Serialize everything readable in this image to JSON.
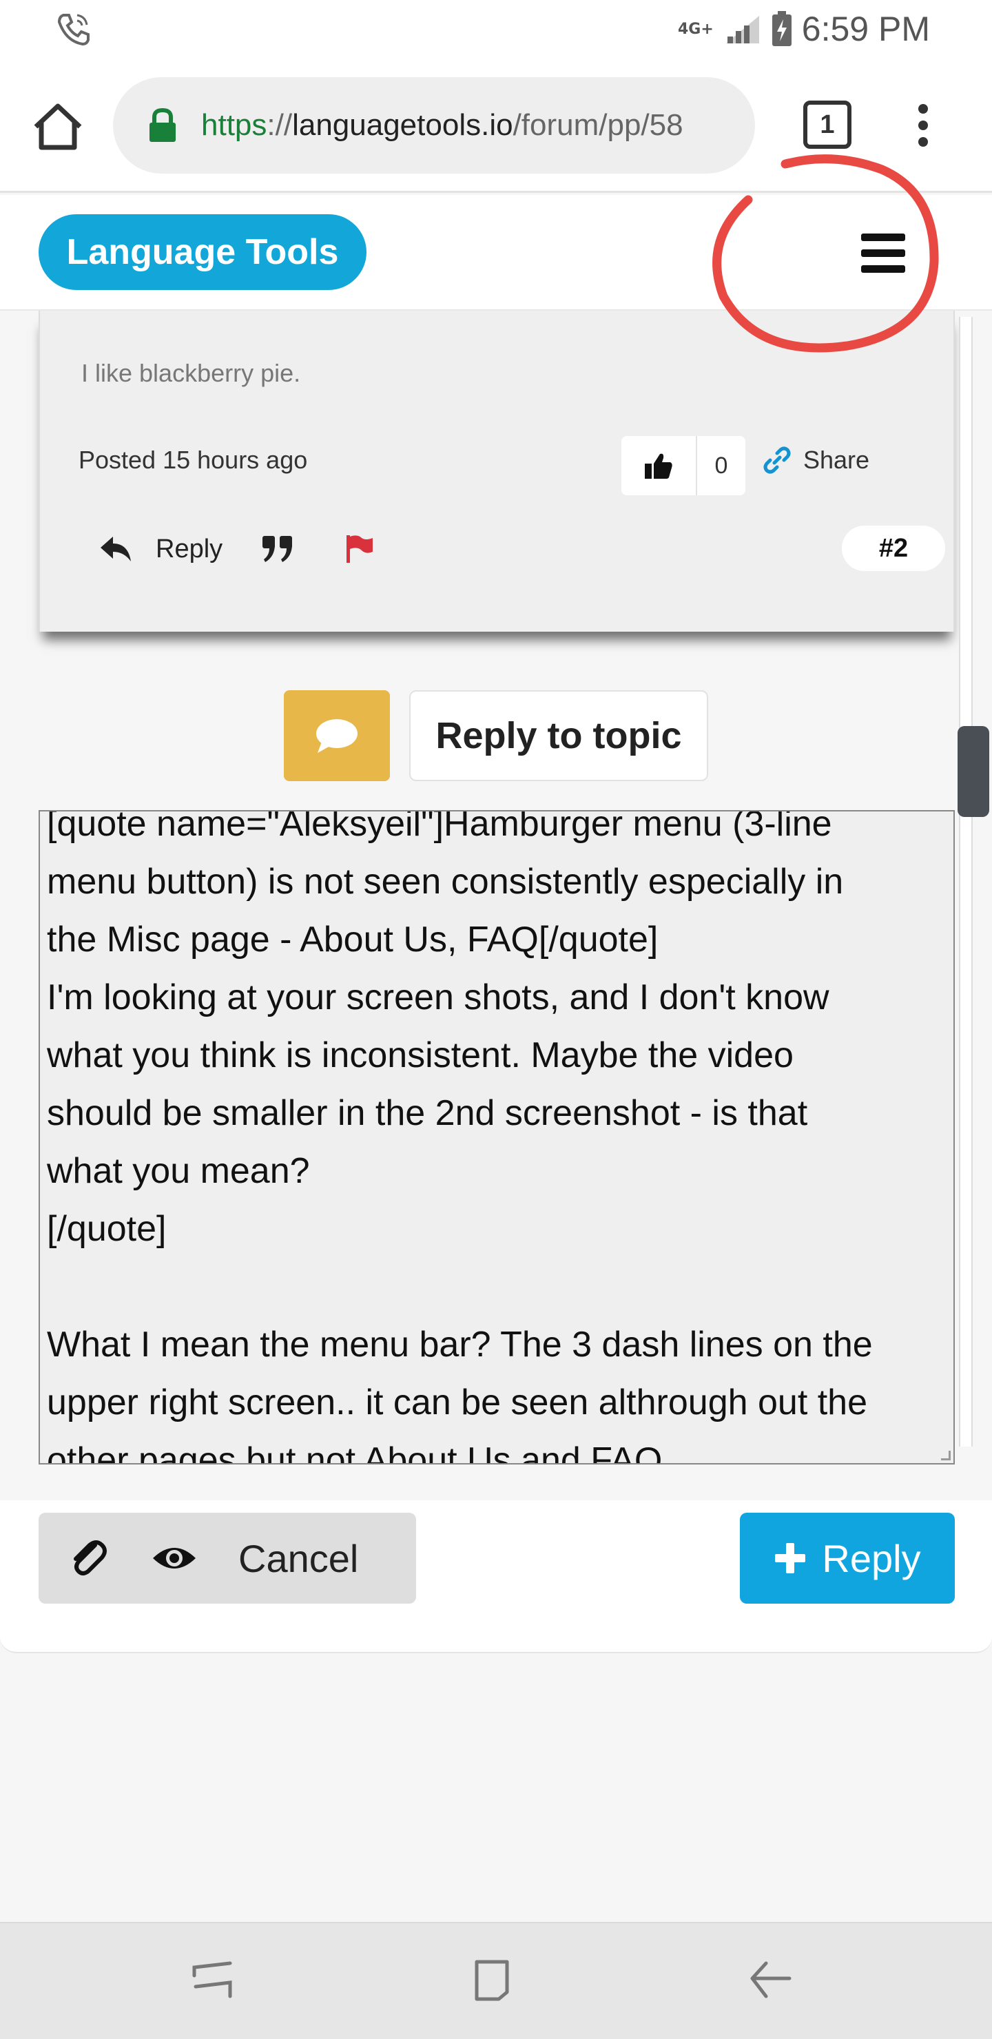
{
  "status_bar": {
    "network": "4G+",
    "time": "6:59 PM",
    "icons": [
      "phone-call-icon",
      "signal-icon",
      "battery-charging-icon"
    ]
  },
  "browser": {
    "url_scheme": "https",
    "url_sep": "://",
    "url_host": "languagetools.io",
    "url_path": "/forum/pp/58",
    "tab_count": "1",
    "icons": [
      "home-icon",
      "lock-icon",
      "tabs-icon",
      "more-vert-icon"
    ]
  },
  "site": {
    "brand": "Language Tools",
    "menu_icon": "hamburger-icon"
  },
  "post": {
    "body": "I like blackberry pie.",
    "posted": "Posted 15 hours ago",
    "like_count": "0",
    "share_label": "Share",
    "reply_label": "Reply",
    "number": "#2",
    "icons": [
      "thumbs-up-icon",
      "link-icon",
      "reply-arrow-icon",
      "quote-icon",
      "flag-icon"
    ]
  },
  "reply_to_topic": {
    "label": "Reply to topic",
    "icon": "chat-bubble-icon"
  },
  "editor": {
    "text": "[quote name=\"Aleksyeil\"]Hamburger menu (3-line\nmenu button) is not seen consistently especially in\nthe Misc page - About Us, FAQ[/quote]\nI'm looking at your screen shots, and I don't know\nwhat you think is inconsistent. Maybe the video\nshould be smaller in the 2nd screenshot - is that\nwhat you mean?\n[/quote]\n\nWhat I mean the menu bar? The 3 dash lines on the\nupper right screen.. it can be seen althrough out the\nother pages but not About Us and FAQ"
  },
  "controls": {
    "cancel_label": "Cancel",
    "reply_label": "Reply",
    "icons": [
      "paperclip-icon",
      "eye-icon",
      "plus-icon"
    ]
  },
  "colors": {
    "brand": "#13a6d8",
    "reply_button": "#10a5df",
    "chat_button": "#e8b74a",
    "flag": "#d9323c",
    "annotation_circle": "#e84a43"
  }
}
